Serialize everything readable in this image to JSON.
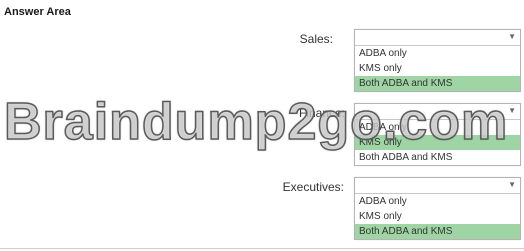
{
  "answer_area": {
    "title": "Answer Area"
  },
  "rows": [
    {
      "label": "Sales:",
      "options": [
        "ADBA only",
        "KMS only",
        "Both ADBA and KMS"
      ],
      "selected_index": 2
    },
    {
      "label": "Finance:",
      "options": [
        "ADBA only",
        "KMS only",
        "Both ADBA and KMS"
      ],
      "selected_index": 1
    },
    {
      "label": "Executives:",
      "options": [
        "ADBA only",
        "KMS only",
        "Both ADBA and KMS"
      ],
      "selected_index": 2
    }
  ],
  "watermark": {
    "text": "Braindump2go.com"
  },
  "colors": {
    "selected": "#9fd4a4",
    "border": "#b4b4b4"
  },
  "icons": {
    "dropdown_arrow": "chevron-down-icon"
  }
}
